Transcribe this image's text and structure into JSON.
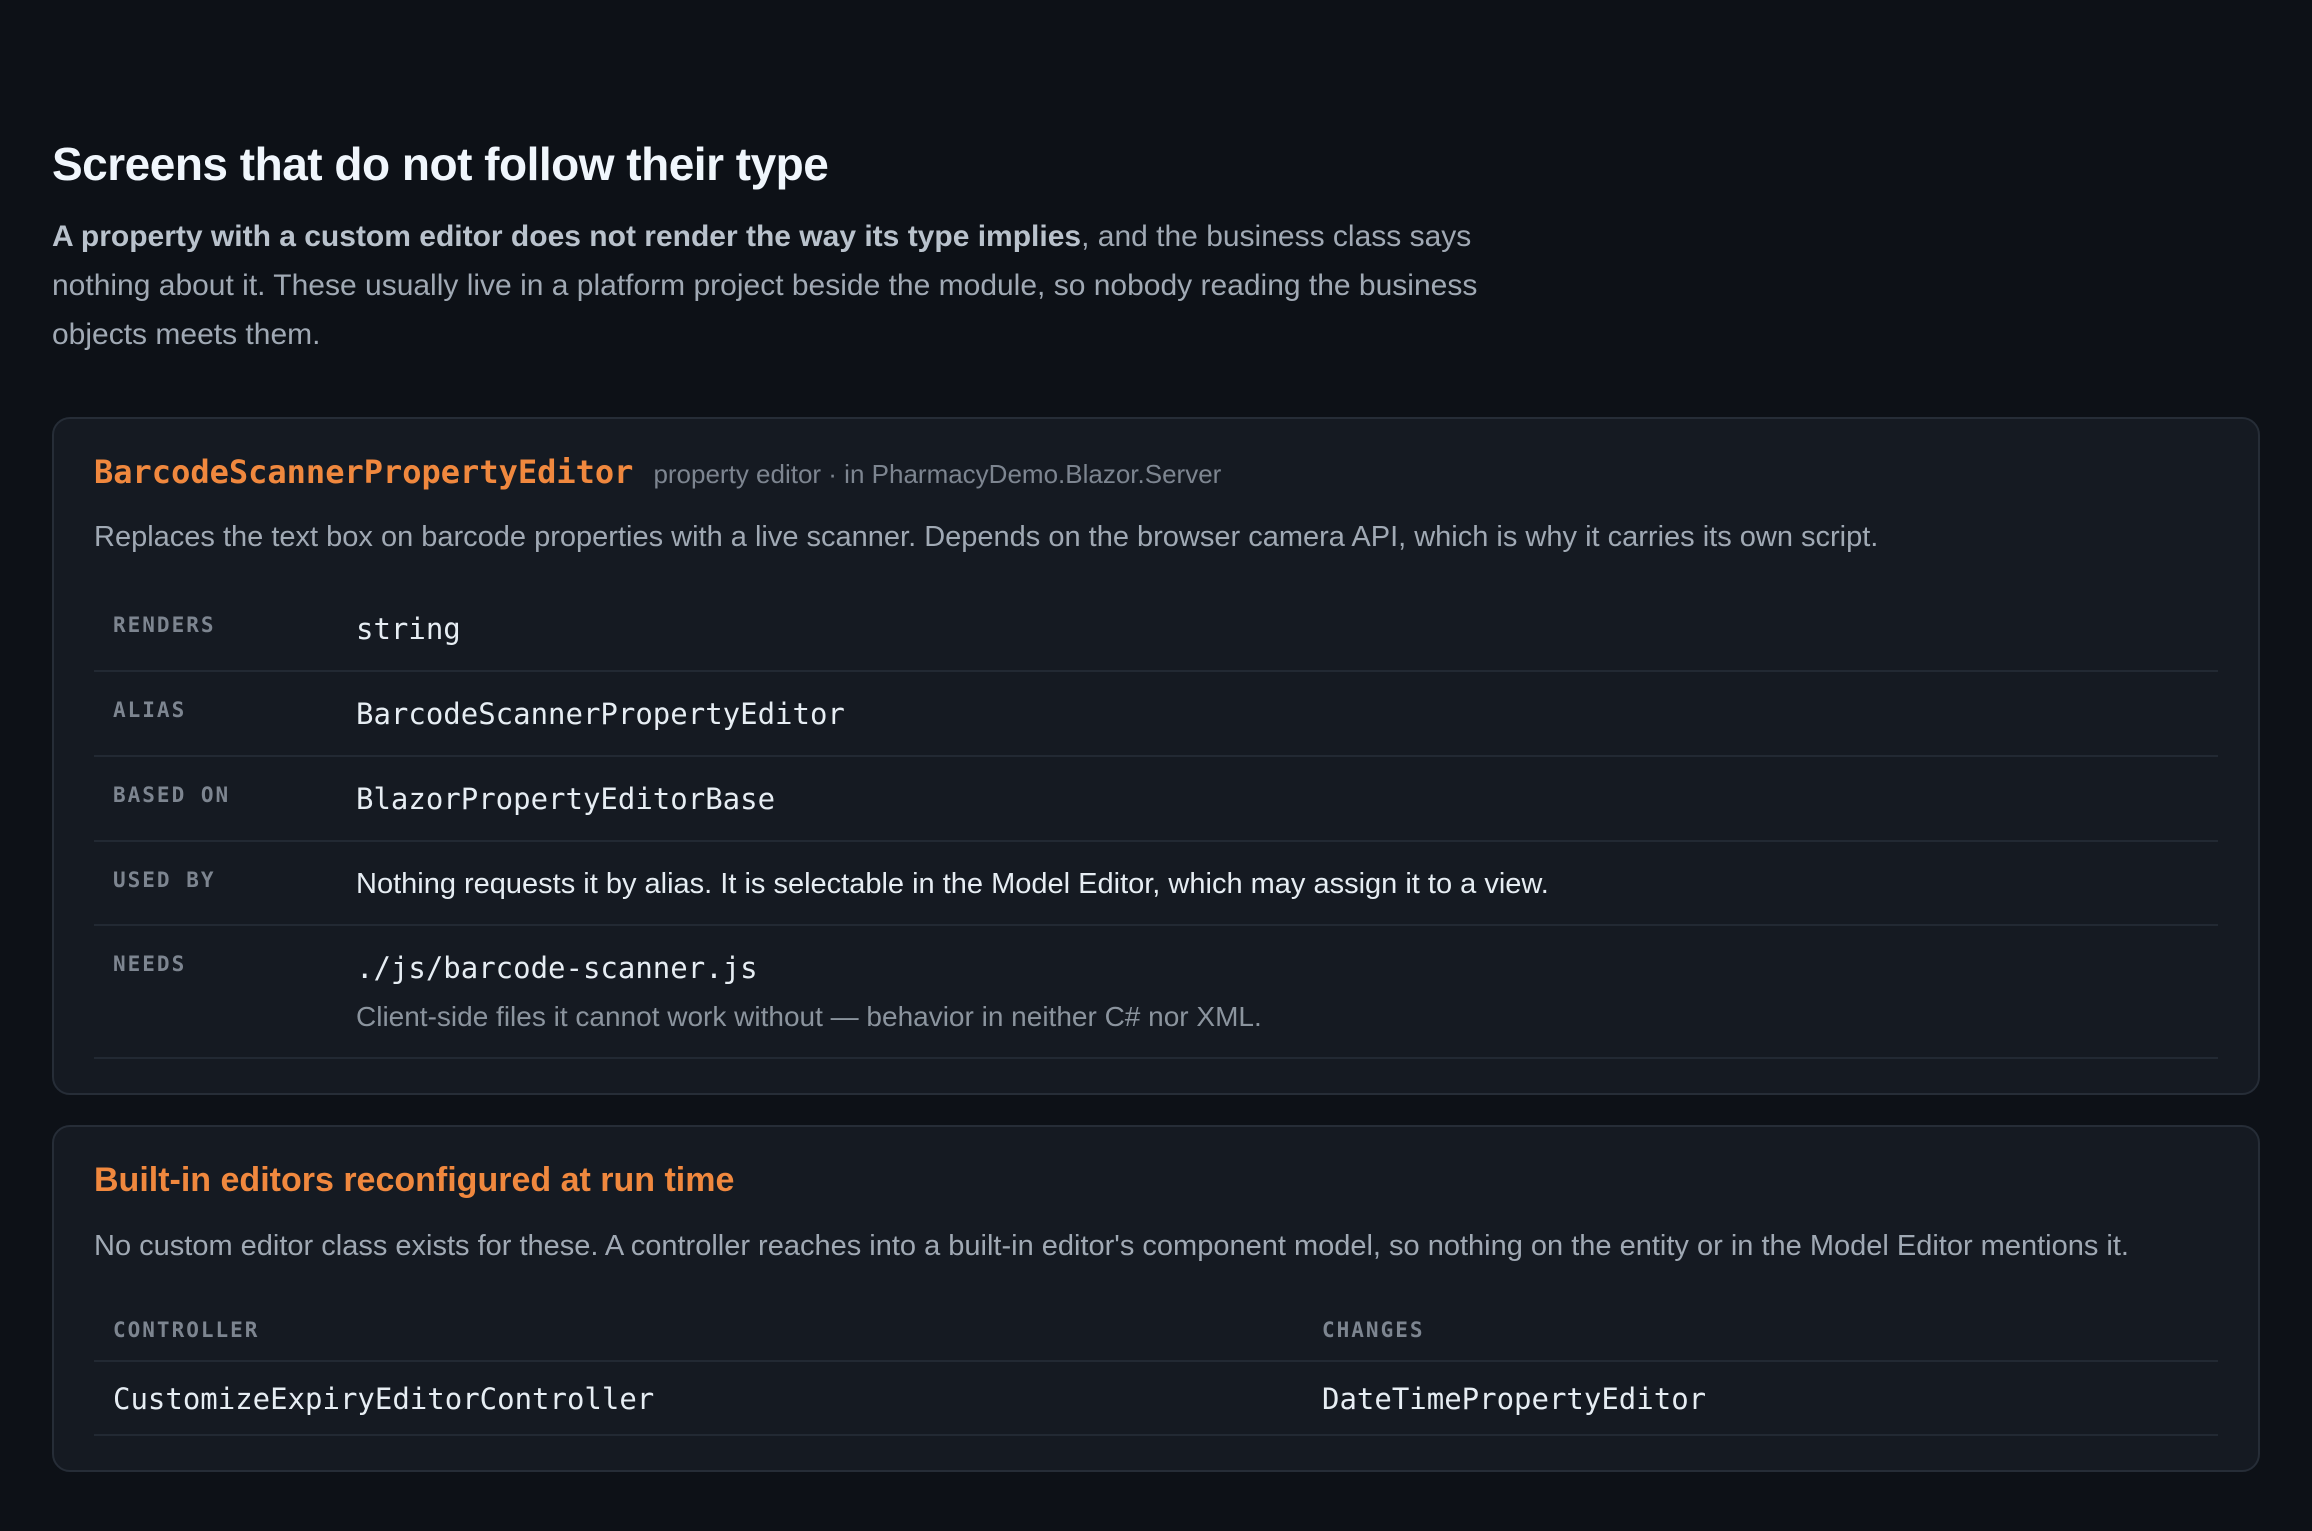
{
  "section": {
    "title": "Screens that do not follow their type",
    "lead_bold": "A property with a custom editor does not render the way its type implies",
    "lead_rest": ", and the business class says nothing about it. These usually live in a platform project beside the module, so nobody reading the business objects meets them."
  },
  "editor_card": {
    "name": "BarcodeScannerPropertyEditor",
    "meta": "property editor · in PharmacyDemo.Blazor.Server",
    "description": "Replaces the text box on barcode properties with a live scanner. Depends on the browser camera API, which is why it carries its own script.",
    "rows": {
      "renders": {
        "key": "RENDERS",
        "value": "string"
      },
      "alias": {
        "key": "ALIAS",
        "value": "BarcodeScannerPropertyEditor"
      },
      "based_on": {
        "key": "BASED ON",
        "value": "BlazorPropertyEditorBase"
      },
      "used_by": {
        "key": "USED BY",
        "value": "Nothing requests it by alias. It is selectable in the Model Editor, which may assign it to a view."
      },
      "needs": {
        "key": "NEEDS",
        "value": "./js/barcode-scanner.js",
        "note": "Client-side files it cannot work without — behavior in neither C# nor XML."
      }
    }
  },
  "builtin_card": {
    "title": "Built-in editors reconfigured at run time",
    "description": "No custom editor class exists for these. A controller reaches into a built-in editor's component model, so nothing on the entity or in the Model Editor mentions it.",
    "columns": {
      "controller": "CONTROLLER",
      "changes": "CHANGES"
    },
    "rows": [
      {
        "controller": "CustomizeExpiryEditorController",
        "changes": "DateTimePropertyEditor"
      }
    ]
  }
}
